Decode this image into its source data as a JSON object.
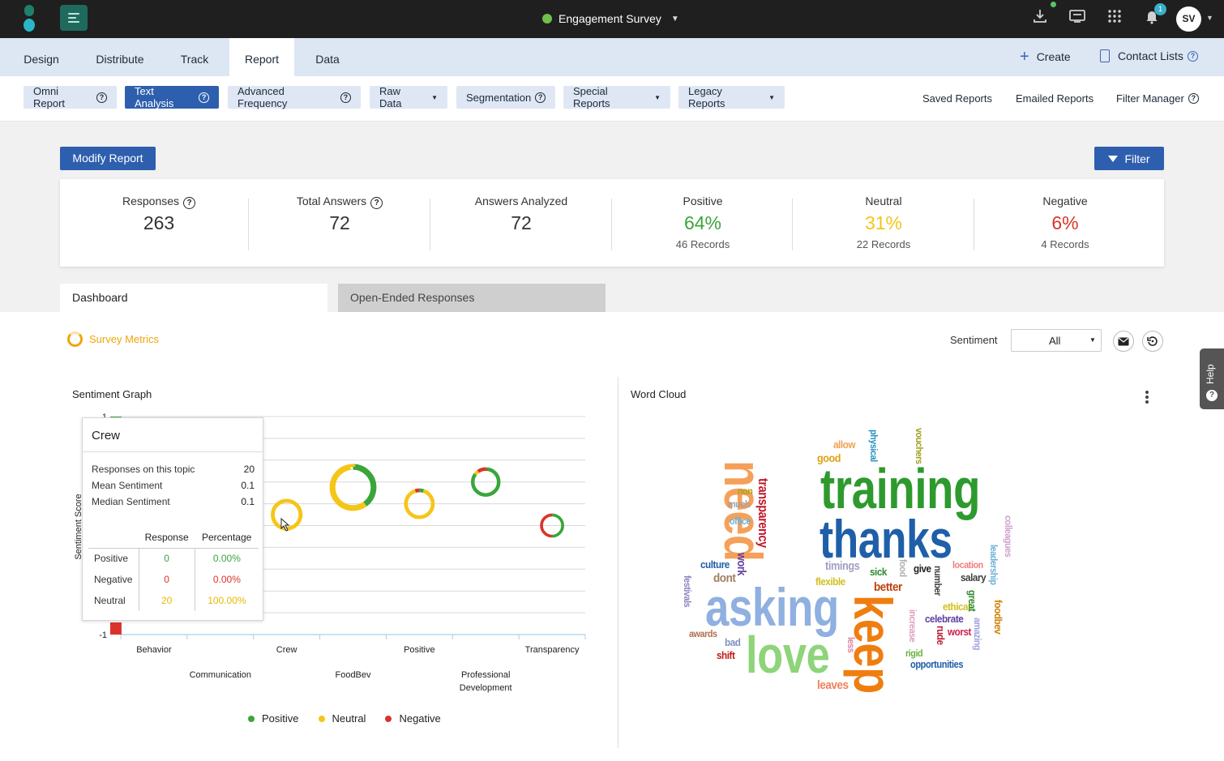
{
  "app": {
    "survey_title": "Engagement Survey",
    "avatar_initials": "SV",
    "notification_count": "1"
  },
  "nav": {
    "tabs": [
      "Design",
      "Distribute",
      "Track",
      "Report",
      "Data"
    ],
    "active_tab": "Report",
    "create_label": "Create",
    "contact_lists_label": "Contact Lists"
  },
  "toolbar": {
    "buttons": {
      "omni": "Omni Report",
      "text_analysis": "Text Analysis",
      "advanced_frequency": "Advanced Frequency",
      "raw_data": "Raw Data",
      "segmentation": "Segmentation",
      "special_reports": "Special Reports",
      "legacy_reports": "Legacy Reports"
    },
    "links": {
      "saved": "Saved Reports",
      "emailed": "Emailed Reports",
      "filter_manager": "Filter Manager"
    },
    "active": "Text Analysis"
  },
  "actions": {
    "modify_report": "Modify Report",
    "filter": "Filter"
  },
  "stats": {
    "responses": {
      "label": "Responses",
      "value": "263"
    },
    "total_answers": {
      "label": "Total Answers",
      "value": "72"
    },
    "answers_analyzed": {
      "label": "Answers Analyzed",
      "value": "72"
    },
    "positive": {
      "label": "Positive",
      "value": "64%",
      "sub": "46 Records",
      "color": "#3aa53a"
    },
    "neutral": {
      "label": "Neutral",
      "value": "31%",
      "sub": "22 Records",
      "color": "#f5c518"
    },
    "negative": {
      "label": "Negative",
      "value": "6%",
      "sub": "4 Records",
      "color": "#d9342b"
    }
  },
  "view_tabs": {
    "dashboard": "Dashboard",
    "open_ended": "Open-Ended Responses"
  },
  "metrics": {
    "title": "Survey Metrics",
    "sentiment_label": "Sentiment",
    "sentiment_value": "All"
  },
  "sentiment_graph": {
    "title": "Sentiment Graph",
    "y_label": "Sentiment Score",
    "legend": [
      {
        "name": "Positive",
        "color": "#3aa53a"
      },
      {
        "name": "Neutral",
        "color": "#f5c518"
      },
      {
        "name": "Negative",
        "color": "#d9342b"
      }
    ]
  },
  "chart_data": {
    "type": "scatter",
    "ylabel": "Sentiment Score",
    "ylim": [
      -1,
      1
    ],
    "y_ticks": [
      "1",
      "-1"
    ],
    "categories": [
      "Behavior",
      "Communication",
      "Crew",
      "FoodBev",
      "Positive",
      "Professional Development",
      "Transparency"
    ],
    "category_labels": [
      [
        "Behavior"
      ],
      [
        "Communication"
      ],
      [
        "Crew"
      ],
      [
        "FoodBev"
      ],
      [
        "Positive"
      ],
      [
        "Professional",
        "Development"
      ],
      [
        "Transparency"
      ]
    ],
    "points": [
      {
        "category": "Behavior",
        "score": 1.0,
        "shape": "bar",
        "color": "#3aa53a"
      },
      {
        "category": "Behavior",
        "score": -1.0,
        "shape": "bar",
        "color": "#d9342b"
      },
      {
        "category": "Crew",
        "score": 0.1,
        "responses": 20,
        "positive_share": 0.0,
        "neutral_share": 1.0,
        "negative_share": 0.0
      },
      {
        "category": "FoodBev",
        "score": 0.35,
        "responses": 60,
        "positive_share": 0.4,
        "neutral_share": 0.6,
        "negative_share": 0.0
      },
      {
        "category": "Positive",
        "score": 0.2,
        "responses": 18,
        "positive_share": 0.05,
        "neutral_share": 0.9,
        "negative_share": 0.05
      },
      {
        "category": "Professional Development",
        "score": 0.4,
        "responses": 16,
        "positive_share": 0.85,
        "neutral_share": 0.05,
        "negative_share": 0.1
      },
      {
        "category": "Transparency",
        "score": 0.0,
        "responses": 8,
        "positive_share": 0.5,
        "neutral_share": 0.0,
        "negative_share": 0.5
      }
    ],
    "series": [
      {
        "name": "Positive",
        "color": "#3aa53a"
      },
      {
        "name": "Neutral",
        "color": "#f5c518"
      },
      {
        "name": "Negative",
        "color": "#d9342b"
      }
    ]
  },
  "tooltip": {
    "title": "Crew",
    "rows": [
      {
        "label": "Responses on this topic",
        "value": "20"
      },
      {
        "label": "Mean Sentiment",
        "value": "0.1"
      },
      {
        "label": "Median Sentiment",
        "value": "0.1"
      }
    ],
    "table_headers": [
      "Response",
      "Percentage"
    ],
    "table_rows": [
      {
        "label": "Positive",
        "response": "0",
        "percentage": "0.00%",
        "color": "#3aa53a"
      },
      {
        "label": "Negative",
        "response": "0",
        "percentage": "0.00%",
        "color": "#d9342b"
      },
      {
        "label": "Neutral",
        "response": "20",
        "percentage": "100.00%",
        "color": "#f5c518"
      }
    ]
  },
  "word_cloud": {
    "title": "Word Cloud",
    "words": [
      {
        "text": "training",
        "color": "#2e9a2e"
      },
      {
        "text": "thanks",
        "color": "#1f5fa8"
      },
      {
        "text": "asking",
        "color": "#8fb0e0"
      },
      {
        "text": "love",
        "color": "#8ed47a"
      },
      {
        "text": "need",
        "color": "#f5a05a"
      },
      {
        "text": "keep",
        "color": "#f07d10"
      },
      {
        "text": "transparency",
        "color": "#c0182a"
      },
      {
        "text": "allow",
        "color": "#f0a050"
      },
      {
        "text": "good",
        "color": "#e0a010"
      },
      {
        "text": "physical",
        "color": "#2090c0"
      },
      {
        "text": "vouchers",
        "color": "#a0a020"
      },
      {
        "text": "non",
        "color": "#b0a010"
      },
      {
        "text": "much",
        "color": "#a0a0a0"
      },
      {
        "text": "office",
        "color": "#6ab0d8"
      },
      {
        "text": "colleagues",
        "color": "#d0a0d0"
      },
      {
        "text": "culture",
        "color": "#1f5fa8"
      },
      {
        "text": "work",
        "color": "#6040a0"
      },
      {
        "text": "timings",
        "color": "#a0a0c0"
      },
      {
        "text": "food",
        "color": "#b0b0b0"
      },
      {
        "text": "give",
        "color": "#202020"
      },
      {
        "text": "location",
        "color": "#f08080"
      },
      {
        "text": "leadership",
        "color": "#6ab0d8"
      },
      {
        "text": "dont",
        "color": "#a08060"
      },
      {
        "text": "sick",
        "color": "#2e8a2e"
      },
      {
        "text": "number",
        "color": "#404040"
      },
      {
        "text": "salary",
        "color": "#404040"
      },
      {
        "text": "flexible",
        "color": "#d0c020"
      },
      {
        "text": "better",
        "color": "#c04010"
      },
      {
        "text": "festivals",
        "color": "#9080c0"
      },
      {
        "text": "ethical",
        "color": "#d0c020"
      },
      {
        "text": "great",
        "color": "#2e8a2e"
      },
      {
        "text": "foodbev",
        "color": "#d08000"
      },
      {
        "text": "increase",
        "color": "#e0a0c0"
      },
      {
        "text": "celebrate",
        "color": "#6040a0"
      },
      {
        "text": "rude",
        "color": "#c01830"
      },
      {
        "text": "amazing",
        "color": "#a0a0e0"
      },
      {
        "text": "worst",
        "color": "#d02050"
      },
      {
        "text": "awards",
        "color": "#b07050"
      },
      {
        "text": "bad",
        "color": "#8090c0"
      },
      {
        "text": "less",
        "color": "#e080a0"
      },
      {
        "text": "rigid",
        "color": "#6ab040"
      },
      {
        "text": "shift",
        "color": "#c01818"
      },
      {
        "text": "opportunities",
        "color": "#1f5fa8"
      },
      {
        "text": "leaves",
        "color": "#f08060"
      }
    ]
  }
}
